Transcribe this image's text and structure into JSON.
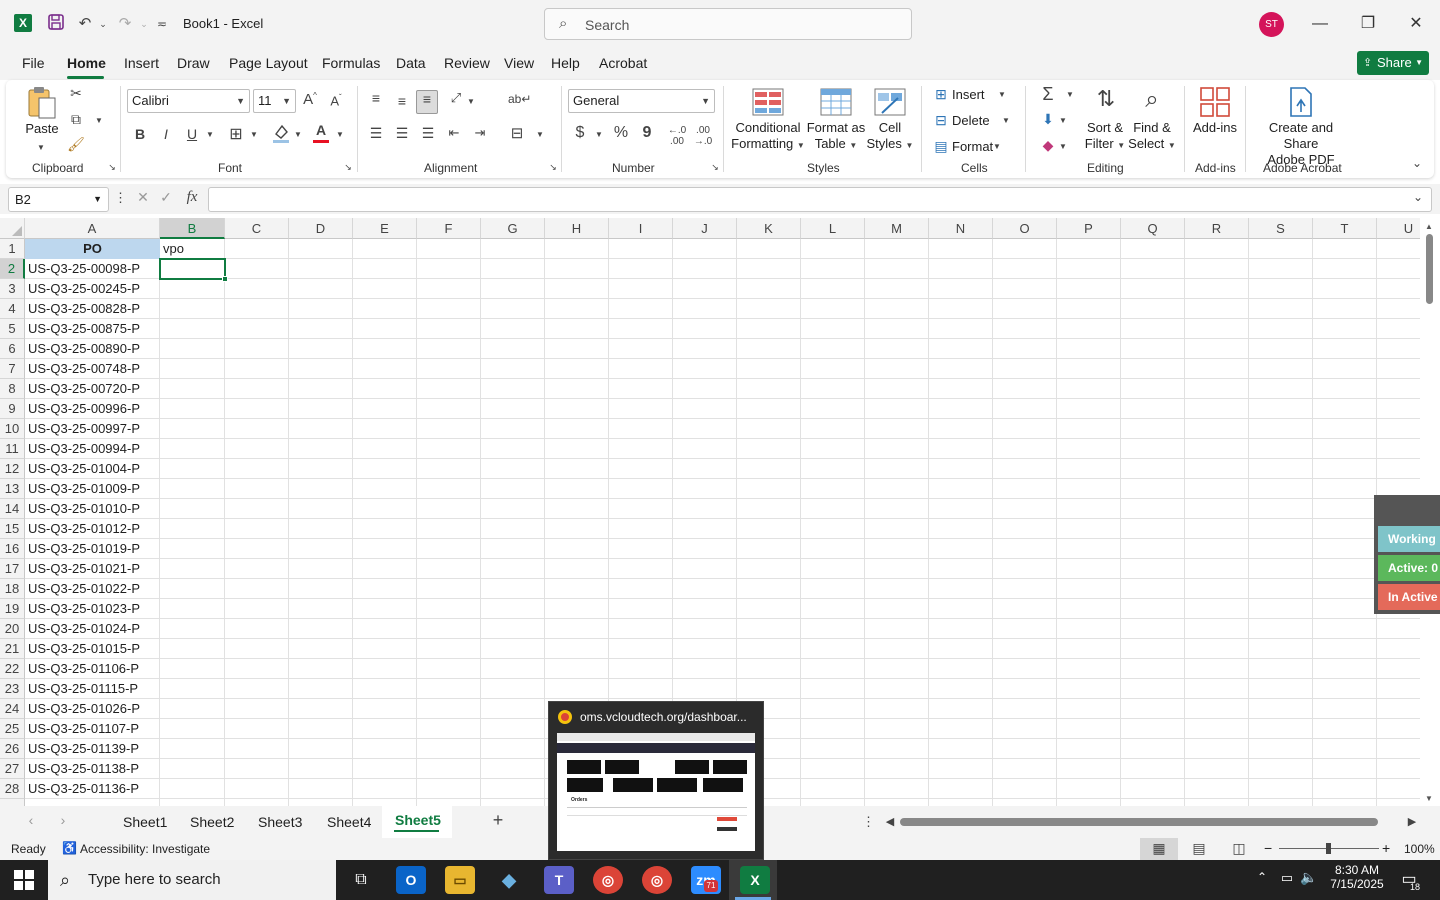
{
  "titlebar": {
    "app_icon": "excel-icon",
    "doc_title": "Book1  -  Excel",
    "search_placeholder": "Search",
    "avatar_initials": "ST"
  },
  "menu": {
    "items": [
      "File",
      "Home",
      "Insert",
      "Draw",
      "Page Layout",
      "Formulas",
      "Data",
      "Review",
      "View",
      "Help",
      "Acrobat"
    ],
    "active": "Home",
    "share_label": "Share"
  },
  "ribbon": {
    "clipboard": {
      "paste": "Paste",
      "label": "Clipboard"
    },
    "font": {
      "name": "Calibri",
      "size": "11",
      "label": "Font",
      "bold": "B",
      "italic": "I",
      "underline": "U",
      "font_color": "#e81123"
    },
    "alignment": {
      "label": "Alignment"
    },
    "number": {
      "format": "General",
      "label": "Number",
      "currency": "$",
      "percent": "%",
      "comma": "9"
    },
    "styles": {
      "conditional": [
        "Conditional",
        "Formatting"
      ],
      "format_table": [
        "Format as",
        "Table"
      ],
      "cell_styles": [
        "Cell",
        "Styles"
      ],
      "label": "Styles"
    },
    "cells": {
      "insert": "Insert",
      "delete": "Delete",
      "format": "Format",
      "label": "Cells"
    },
    "editing": {
      "sort": [
        "Sort &",
        "Filter"
      ],
      "find": [
        "Find &",
        "Select"
      ],
      "label": "Editing"
    },
    "addins": {
      "addins": "Add-ins",
      "label": "Add-ins"
    },
    "acrobat": {
      "create": [
        "Create and Share",
        "Adobe PDF"
      ],
      "label": "Adobe Acrobat"
    }
  },
  "formula_bar": {
    "name_box": "B2",
    "fx": "fx",
    "value": ""
  },
  "sheet": {
    "columns": [
      "A",
      "B",
      "C",
      "D",
      "E",
      "F",
      "G",
      "H",
      "I",
      "J",
      "K",
      "L",
      "M",
      "N",
      "O",
      "P",
      "Q",
      "R",
      "S",
      "T",
      "U"
    ],
    "header_a": "PO",
    "header_b": "vpo",
    "rows": [
      "1",
      "2",
      "3",
      "4",
      "5",
      "6",
      "7",
      "8",
      "9",
      "10",
      "11",
      "12",
      "13",
      "14",
      "15",
      "16",
      "17",
      "18",
      "19",
      "20",
      "21",
      "22",
      "23",
      "24",
      "25",
      "26",
      "27",
      "28"
    ],
    "po_values": [
      "US-Q3-25-00098-P",
      "US-Q3-25-00245-P",
      "US-Q3-25-00828-P",
      "US-Q3-25-00875-P",
      "US-Q3-25-00890-P",
      "US-Q3-25-00748-P",
      "US-Q3-25-00720-P",
      "US-Q3-25-00996-P",
      "US-Q3-25-00997-P",
      "US-Q3-25-00994-P",
      "US-Q3-25-01004-P",
      "US-Q3-25-01009-P",
      "US-Q3-25-01010-P",
      "US-Q3-25-01012-P",
      "US-Q3-25-01019-P",
      "US-Q3-25-01021-P",
      "US-Q3-25-01022-P",
      "US-Q3-25-01023-P",
      "US-Q3-25-01024-P",
      "US-Q3-25-01015-P",
      "US-Q3-25-01106-P",
      "US-Q3-25-01115-P",
      "US-Q3-25-01026-P",
      "US-Q3-25-01107-P",
      "US-Q3-25-01139-P",
      "US-Q3-25-01138-P",
      "US-Q3-25-01136-P"
    ],
    "selected_cell": "B2"
  },
  "side_panel": {
    "working": "Working",
    "active": "Active: 0",
    "inactive": "In Active",
    "colors": {
      "working": "#7fc4c9",
      "active": "#5cb85c",
      "inactive": "#e46a5a",
      "frame": "#555555"
    }
  },
  "tabs": {
    "sheets": [
      "Sheet1",
      "Sheet2",
      "Sheet3",
      "Sheet4",
      "Sheet5"
    ],
    "active": "Sheet5",
    "add": "+"
  },
  "status": {
    "ready": "Ready",
    "accessibility": "Accessibility: Investigate",
    "zoom": "100%",
    "zoom_minus": "−",
    "zoom_plus": "+"
  },
  "taskbar": {
    "search_placeholder": "Type here to search",
    "time": "8:30 AM",
    "date": "7/15/2025",
    "notifications": "18",
    "zoom_badge": "71"
  },
  "popup": {
    "title": "oms.vcloudtech.org/dashboar...",
    "preview_heading": "Orders"
  }
}
